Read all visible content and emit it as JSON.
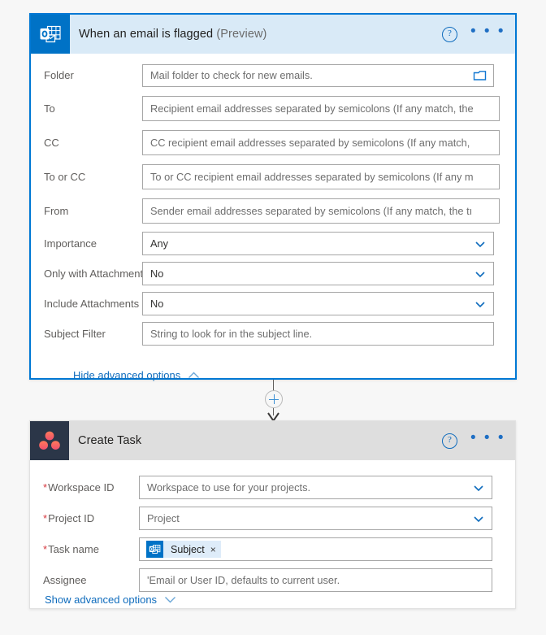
{
  "theme": {
    "accent": "#0078d4",
    "trigger_header_bg": "#d9eaf7",
    "action_header_bg": "#dedede",
    "outlook_brand": "#0072c6",
    "asana_brand": "#2b3648",
    "required_marker": "#d6383f",
    "link_color": "#0f6cbd",
    "canvas_bg": "#f7f7f7"
  },
  "trigger_card": {
    "icon_name": "outlook-icon",
    "title": "When an email is flagged",
    "title_suffix": "(Preview)",
    "help_label": "?",
    "more_label": "• • •",
    "fields": [
      {
        "label": "Folder",
        "type": "text-with-picker",
        "placeholder": "Mail folder to check for new emails.",
        "value": "",
        "icon_name": "folder-picker-icon"
      },
      {
        "label": "To",
        "type": "text",
        "placeholder": "Recipient email addresses separated by semicolons (If any match, the",
        "value": ""
      },
      {
        "label": "CC",
        "type": "text",
        "placeholder": "CC recipient email addresses separated by semicolons (If any match,",
        "value": ""
      },
      {
        "label": "To or CC",
        "type": "text",
        "placeholder": "To or CC recipient email addresses separated by semicolons (If any m",
        "value": ""
      },
      {
        "label": "From",
        "type": "text",
        "placeholder": "Sender email addresses separated by semicolons (If any match, the tı",
        "value": ""
      },
      {
        "label": "Importance",
        "type": "dropdown",
        "placeholder": "",
        "value": "Any"
      },
      {
        "label": "Only with Attachments",
        "type": "dropdown",
        "placeholder": "",
        "value": "No"
      },
      {
        "label": "Include Attachments",
        "type": "dropdown",
        "placeholder": "",
        "value": "No"
      },
      {
        "label": "Subject Filter",
        "type": "text",
        "placeholder": "String to look for in the subject line.",
        "value": ""
      }
    ],
    "advanced_link": {
      "label": "Hide advanced options",
      "caret": "chevron-up-icon"
    }
  },
  "connector": {
    "add_button_label": "+",
    "arrow_name": "arrow-down-icon"
  },
  "action_card": {
    "icon_name": "asana-icon",
    "title": "Create Task",
    "help_label": "?",
    "more_label": "• • •",
    "fields": [
      {
        "label": "Workspace ID",
        "required": true,
        "type": "dropdown",
        "placeholder": "Workspace to use for your projects.",
        "value": ""
      },
      {
        "label": "Project ID",
        "required": true,
        "type": "dropdown",
        "placeholder": "Project",
        "value": ""
      },
      {
        "label": "Task name",
        "required": true,
        "type": "token",
        "placeholder": "",
        "token": {
          "icon_name": "outlook-icon",
          "label": "Subject",
          "remove_label": "×"
        }
      },
      {
        "label": "Assignee",
        "required": false,
        "type": "text",
        "placeholder": "'Email or User ID, defaults to current user.",
        "value": ""
      }
    ],
    "advanced_link": {
      "label": "Show advanced options",
      "caret": "chevron-down-icon"
    }
  }
}
